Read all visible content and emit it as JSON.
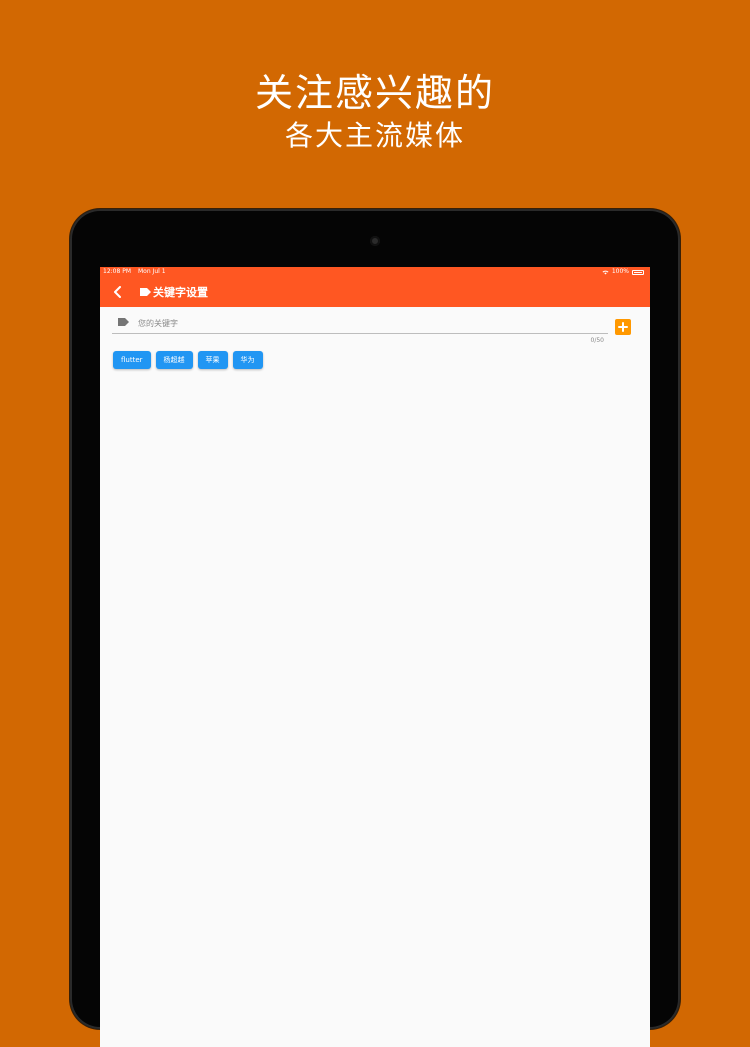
{
  "promo": {
    "title": "关注感兴趣的",
    "subtitle": "各大主流媒体"
  },
  "status_bar": {
    "time": "12:08 PM",
    "date": "Mon Jul 1",
    "battery": "100%"
  },
  "app_bar": {
    "back_icon": "chevron-left-icon",
    "title_icon": "label-icon",
    "title": "关键字设置"
  },
  "keyword_input": {
    "placeholder": "您的关键字",
    "value": "",
    "counter": "0/50",
    "icon": "label-icon"
  },
  "add_button": {
    "icon": "plus-icon"
  },
  "keywords": [
    "flutter",
    "杨超越",
    "苹果",
    "华为"
  ],
  "colors": {
    "background": "#D26802",
    "app_bar": "#FF5722",
    "chip": "#2196F3",
    "add_button": "#FF9800"
  }
}
